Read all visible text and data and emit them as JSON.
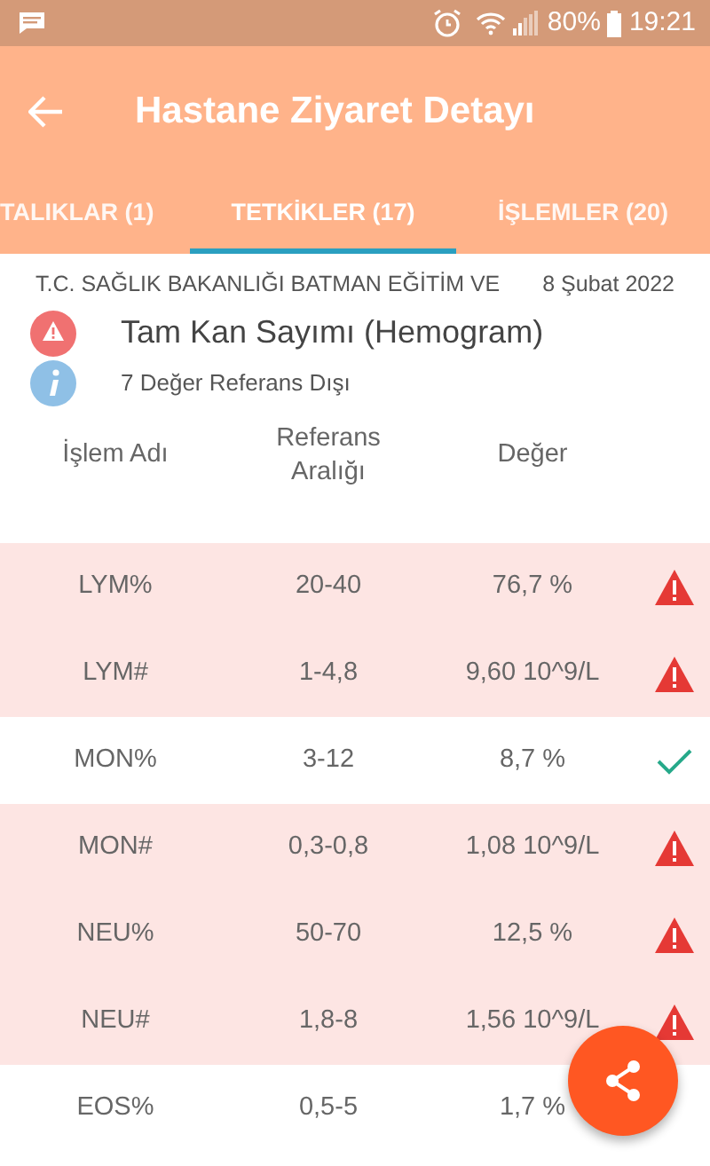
{
  "status_bar": {
    "battery": "80%",
    "time": "19:21"
  },
  "app_bar": {
    "title": "Hastane Ziyaret Detayı"
  },
  "tabs": [
    {
      "label": "TALIKLAR (1)",
      "selected": false
    },
    {
      "label": "TETKİKLER (17)",
      "selected": true
    },
    {
      "label": "İŞLEMLER (20)",
      "selected": false
    }
  ],
  "test": {
    "hospital": "T.C. SAĞLIK BAKANLIĞI BATMAN EĞİTİM VE",
    "date": "8 Şubat 2022",
    "name": "Tam Kan Sayımı (Hemogram)",
    "info": "7 Değer Referans Dışı"
  },
  "table": {
    "columns": [
      "İşlem Adı",
      "Referans Aralığı",
      "Değer"
    ],
    "rows": [
      {
        "name": "LYM%",
        "range": "20-40",
        "value": "76,7 %",
        "abnormal": true
      },
      {
        "name": "LYM#",
        "range": "1-4,8",
        "value": "9,60 10^9/L",
        "abnormal": true
      },
      {
        "name": "MON%",
        "range": "3-12",
        "value": "8,7 %",
        "abnormal": false
      },
      {
        "name": "MON#",
        "range": "0,3-0,8",
        "value": "1,08 10^9/L",
        "abnormal": true
      },
      {
        "name": "NEU%",
        "range": "50-70",
        "value": "12,5 %",
        "abnormal": true
      },
      {
        "name": "NEU#",
        "range": "1,8-8",
        "value": "1,56 10^9/L",
        "abnormal": true
      },
      {
        "name": "EOS%",
        "range": "0,5-5",
        "value": "1,7 %",
        "abnormal": false
      }
    ]
  }
}
